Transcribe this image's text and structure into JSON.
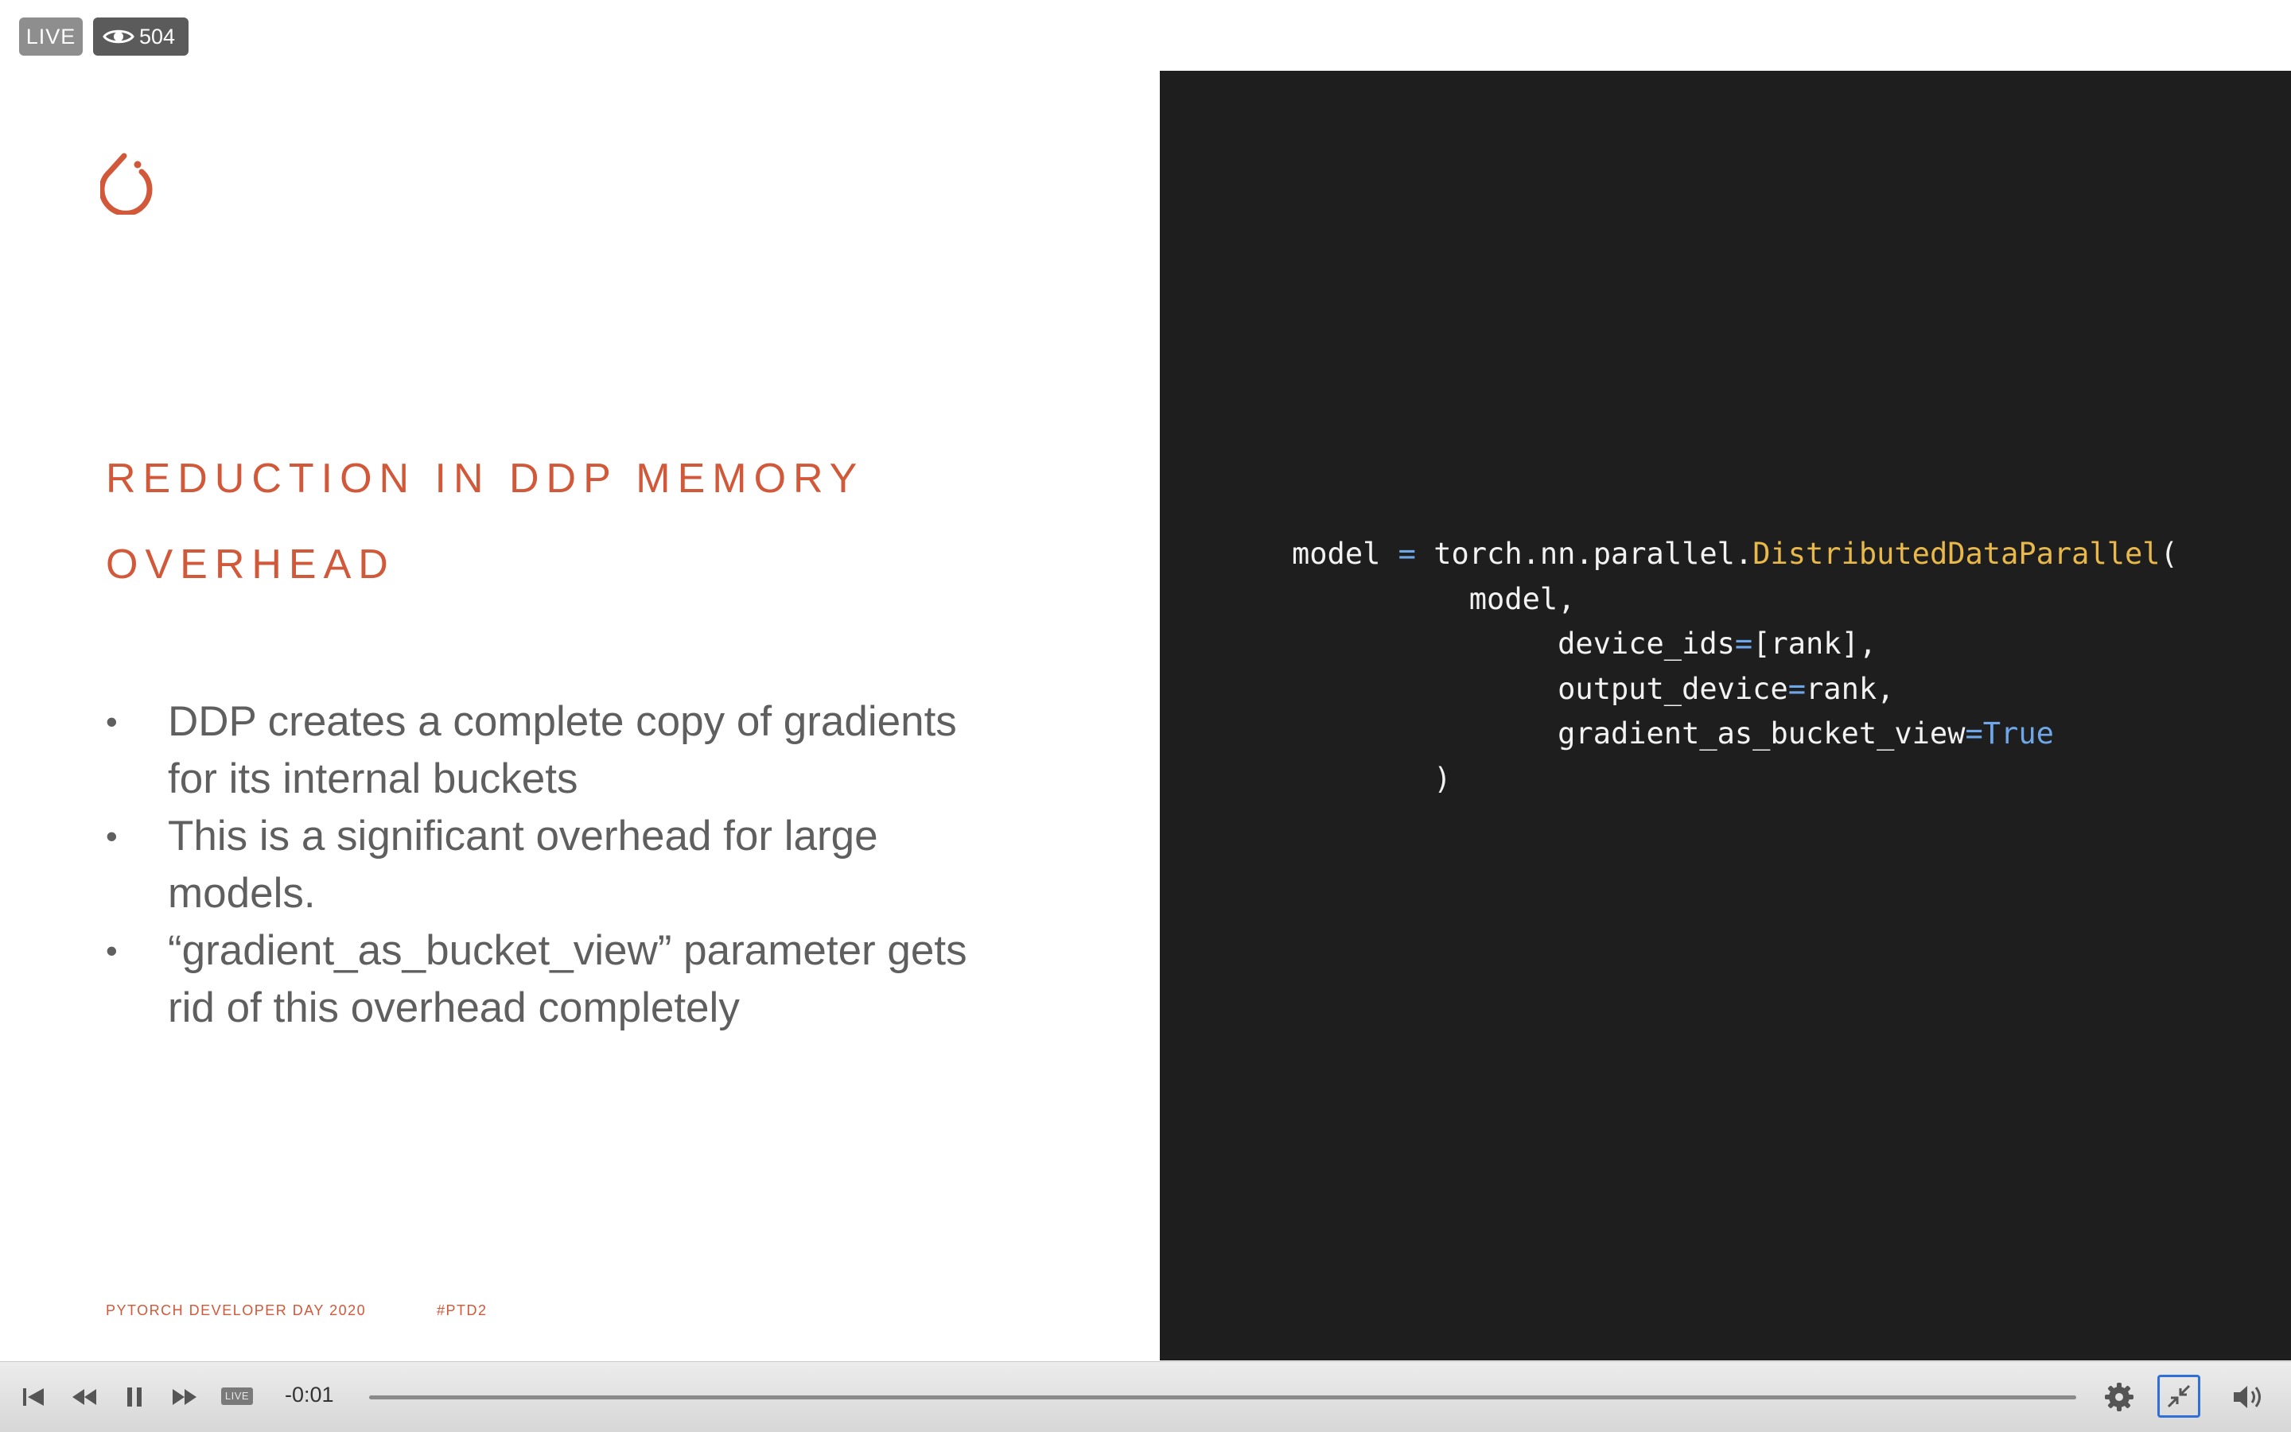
{
  "overlay": {
    "live_label": "LIVE",
    "viewer_count": "504",
    "viewer_icon": "eye-icon"
  },
  "slide": {
    "logo_icon": "pytorch-flame-logo",
    "accent_color": "#d2583a",
    "title_line1": "REDUCTION IN DDP MEMORY",
    "title_line2": "OVERHEAD",
    "bullets": [
      {
        "line1": "DDP creates a complete copy of gradients",
        "line2": "for its internal buckets"
      },
      {
        "line1": "This is a significant overhead for large",
        "line2": "models."
      },
      {
        "line1": "“gradient_as_bucket_view” parameter gets",
        "line2": "rid of this overhead completely"
      }
    ],
    "bullet_symbol": "•",
    "footer_event": "PYTORCH DEVELOPER DAY 2020",
    "footer_hashtag": "#PTD2"
  },
  "code": {
    "background": "#1e1e1e",
    "line1_var": "model",
    "line1_op": "=",
    "line1_module": "torch.nn.parallel.",
    "line1_class": "DistributedDataParallel",
    "line1_paren": "(",
    "line2": "model,",
    "line3_name": "device_ids",
    "line3_op": "=",
    "line3_value": "[rank],",
    "line4_name": "output_device",
    "line4_op": "=",
    "line4_value": "rank,",
    "line5_name": "gradient_as_bucket_view",
    "line5_op": "=",
    "line5_value": "True",
    "line6": ")"
  },
  "player": {
    "time_remaining": "-0:01",
    "live_label": "LIVE",
    "progress_fraction": 1.0,
    "icons": [
      "skip-back-icon",
      "rewind-icon",
      "pause-icon",
      "fast-forward-icon",
      "settings-gear-icon",
      "exit-fullscreen-icon",
      "volume-icon"
    ]
  }
}
